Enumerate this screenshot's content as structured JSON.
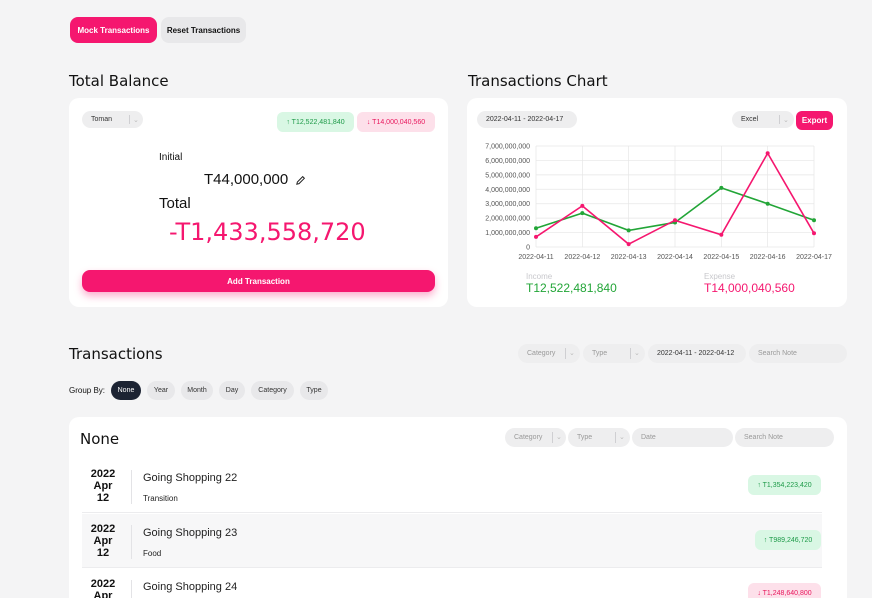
{
  "toolbar": {
    "mock_label": "Mock Transactions",
    "reset_label": "Reset Transactions"
  },
  "balance": {
    "title": "Total Balance",
    "currency": "Toman",
    "income_badge": "↑ T12,522,481,840",
    "expense_badge": "↓ T14,000,040,560",
    "initial_label": "Initial",
    "initial_value": "T44,000,000",
    "total_label": "Total",
    "total_value": "-T1,433,558,720",
    "add_label": "Add Transaction"
  },
  "chart_panel": {
    "title": "Transactions Chart",
    "date_range": "2022-04-11 - 2022-04-17",
    "format": "Excel",
    "export_label": "Export",
    "income_label": "Income",
    "income_value": "T12,522,481,840",
    "expense_label": "Expense",
    "expense_value": "T14,000,040,560"
  },
  "chart_data": {
    "type": "line",
    "categories": [
      "2022-04-11",
      "2022-04-12",
      "2022-04-13",
      "2022-04-14",
      "2022-04-15",
      "2022-04-16",
      "2022-04-17"
    ],
    "y_ticks": [
      "0",
      "1,000,000,000",
      "2,000,000,000",
      "3,000,000,000",
      "4,000,000,000",
      "5,000,000,000",
      "6,000,000,000",
      "7,000,000,000"
    ],
    "ylim": [
      0,
      7000000000
    ],
    "grid": true,
    "series": [
      {
        "name": "Income",
        "color": "#22a537",
        "values": [
          1300000000,
          2350000000,
          1150000000,
          1700000000,
          4100000000,
          3000000000,
          1850000000
        ]
      },
      {
        "name": "Expense",
        "color": "#f5176f",
        "values": [
          700000000,
          2850000000,
          200000000,
          1850000000,
          850000000,
          6500000000,
          950000000
        ]
      }
    ]
  },
  "transactions": {
    "title": "Transactions",
    "filters": {
      "category": "Category",
      "type": "Type",
      "date": "2022-04-11 - 2022-04-12",
      "search": "Search Note"
    },
    "group_by_label": "Group By:",
    "group_options": [
      "None",
      "Year",
      "Month",
      "Day",
      "Category",
      "Type"
    ],
    "group_title": "None",
    "inner_filters": {
      "category": "Category",
      "type": "Type",
      "date": "Date",
      "search": "Search Note"
    },
    "rows": [
      {
        "year": "2022",
        "month": "Apr",
        "day": "12",
        "title": "Going Shopping 22",
        "category": "Transition",
        "amount": "↑ T1,354,223,420",
        "kind": "income"
      },
      {
        "year": "2022",
        "month": "Apr",
        "day": "12",
        "title": "Going Shopping 23",
        "category": "Food",
        "amount": "↑ T989,246,720",
        "kind": "income"
      },
      {
        "year": "2022",
        "month": "Apr",
        "day": "",
        "title": "Going Shopping 24",
        "category": "",
        "amount": "↓ T1,248,640,800",
        "kind": "expense"
      }
    ]
  },
  "colors": {
    "accent": "#f5176f",
    "income": "#22a537",
    "expense": "#f5176f"
  },
  "icons": {
    "edit": "pencil-icon",
    "chevron": "chevron-down-icon"
  }
}
